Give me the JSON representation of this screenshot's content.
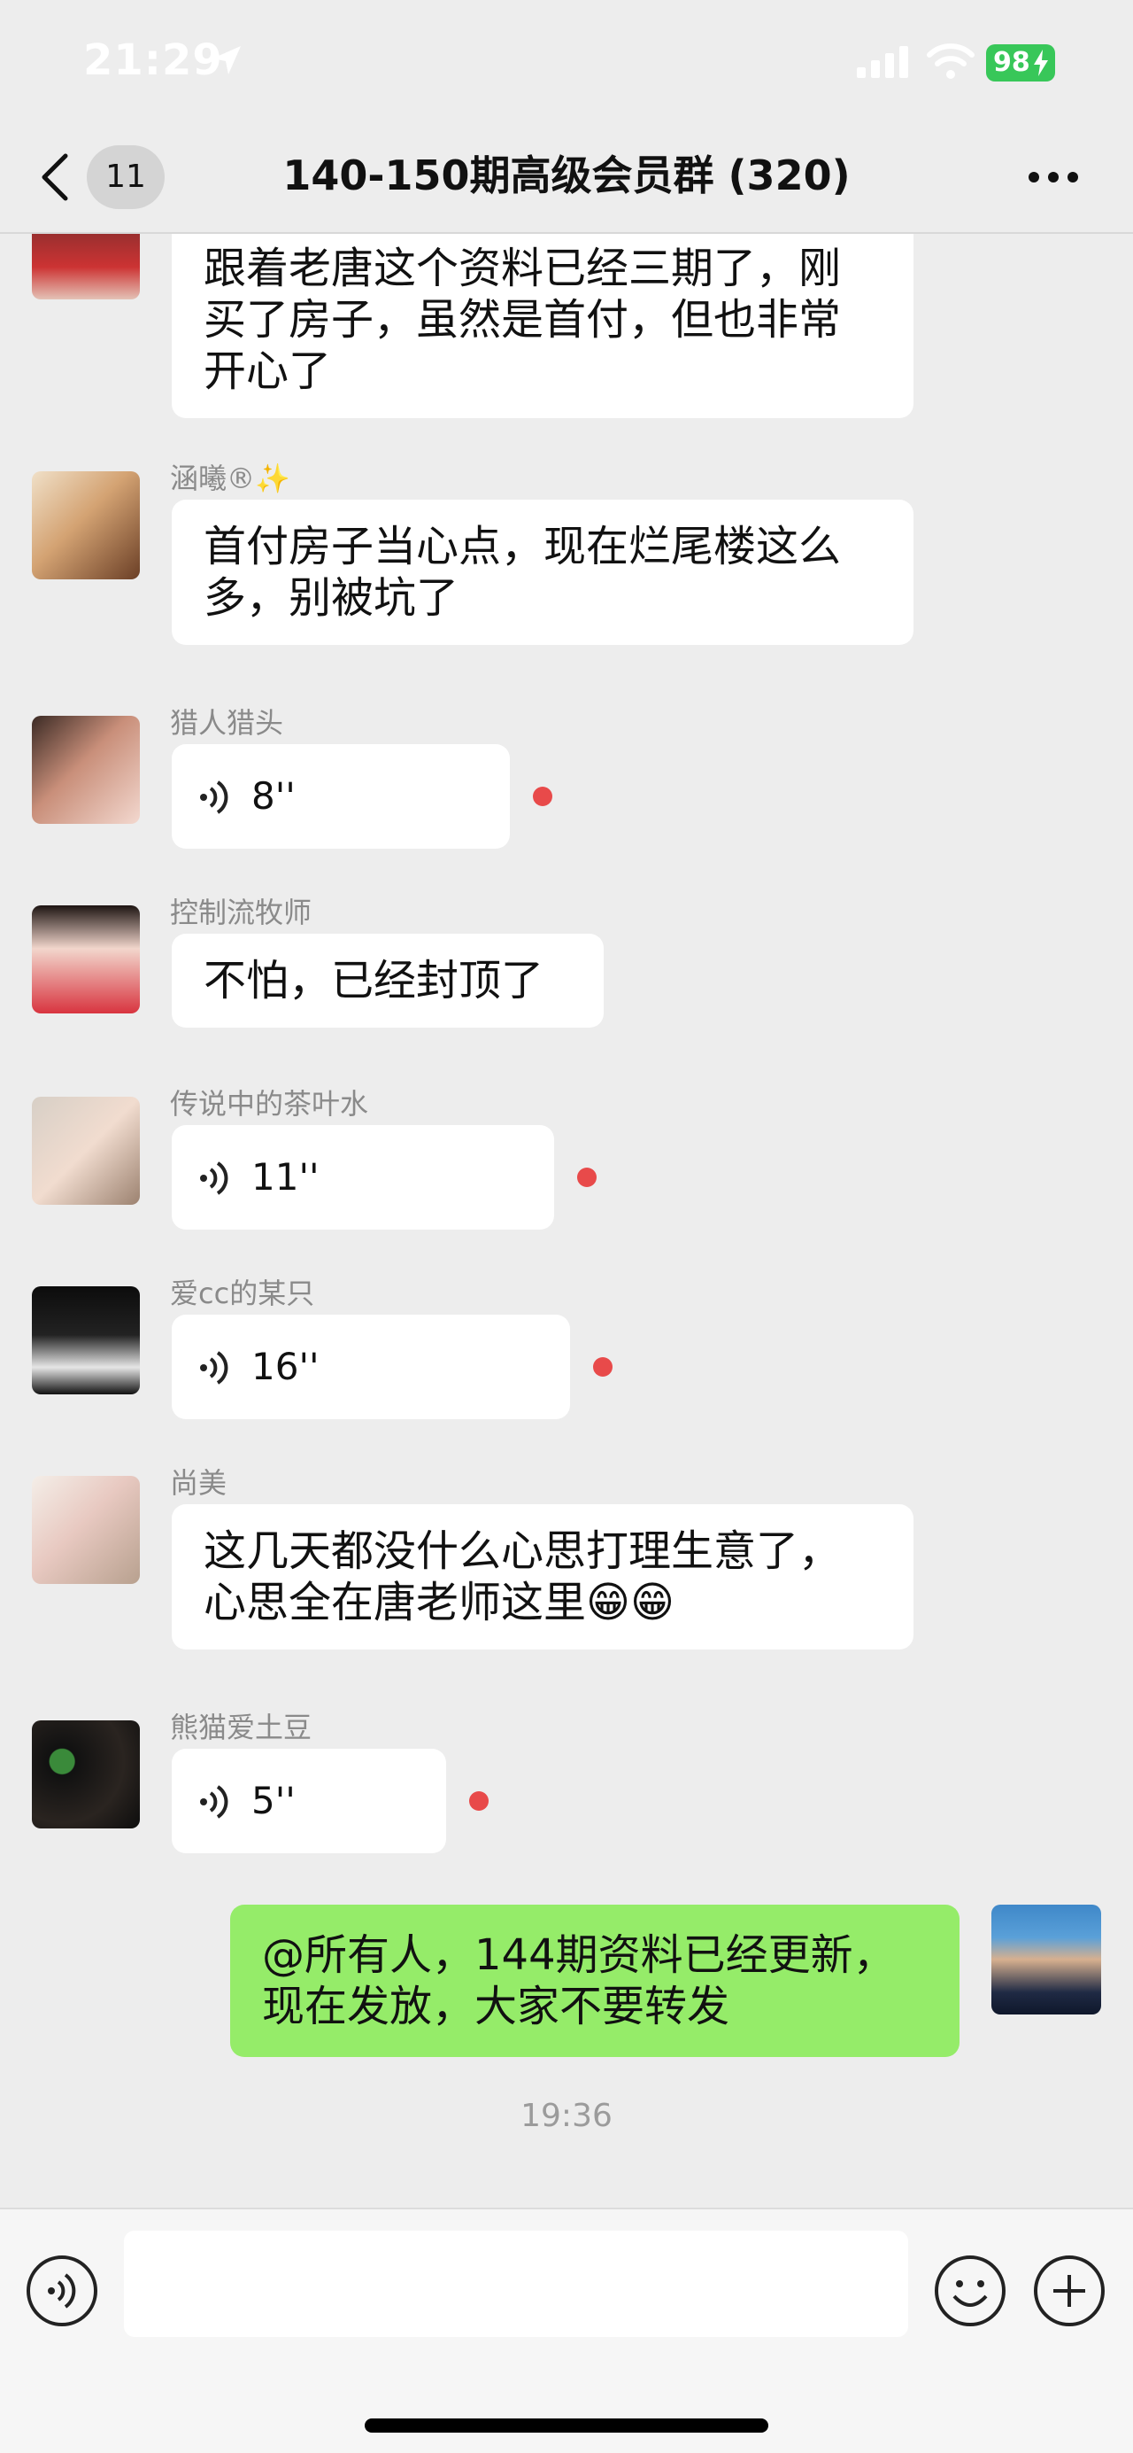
{
  "status": {
    "time": "21:29",
    "battery": "98"
  },
  "header": {
    "unread_count": "11",
    "title": "140-150期高级会员群 (320)"
  },
  "messages": [
    {
      "type": "text",
      "sender": "",
      "text_lines": [
        "跟着老唐这个资料已经三期了，刚",
        "买了房子，虽然是首付，但也非常",
        "开心了"
      ]
    },
    {
      "type": "text",
      "sender": "涵曦®✨",
      "text_lines": [
        "首付房子当心点，现在烂尾楼这么",
        "多，别被坑了"
      ]
    },
    {
      "type": "voice",
      "sender": "猎人猎头",
      "duration": "8''"
    },
    {
      "type": "text",
      "sender": "控制流牧师",
      "text_lines": [
        "不怕，已经封顶了"
      ]
    },
    {
      "type": "voice",
      "sender": "传说中的茶叶水",
      "duration": "11''"
    },
    {
      "type": "voice",
      "sender": "爱cc的某只",
      "duration": "16''"
    },
    {
      "type": "text",
      "sender": "尚美",
      "text_lines": [
        "这几天都没什么心思打理生意了，",
        "心思全在唐老师这里😁😁"
      ]
    },
    {
      "type": "voice",
      "sender": "熊猫爱土豆",
      "duration": "5''"
    }
  ],
  "outgoing": {
    "text_lines": [
      "@所有人，144期资料已经更新，",
      "现在发放，大家不要转发"
    ]
  },
  "timestamp": "19:36",
  "colors": {
    "background": "#ededed",
    "incoming_bubble": "#ffffff",
    "outgoing_bubble": "#95ec69",
    "unread_dot": "#e84a4a",
    "battery": "#38c759"
  },
  "icons": {
    "back": "chevron-left-icon",
    "more": "more-dots-icon",
    "voice_play": "voice-wave-icon",
    "input_voice": "voice-input-icon",
    "emoji": "emoji-icon",
    "plus": "plus-icon"
  }
}
